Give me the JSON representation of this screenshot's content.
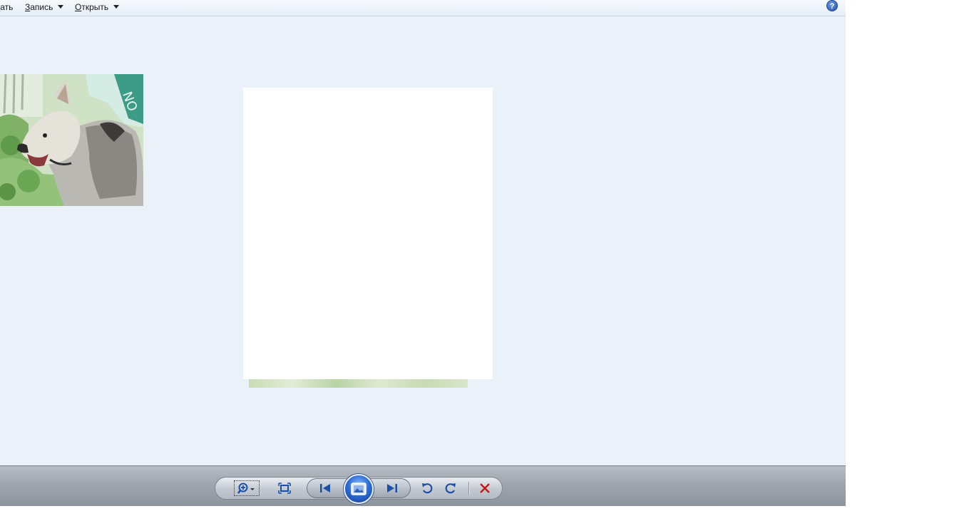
{
  "menubar": {
    "print_label": "чать",
    "burn_label": "Запись",
    "open_label": "Открыть",
    "help_glyph": "?"
  },
  "viewer": {
    "images": [
      "dog-photo",
      "blank-white-photo",
      "partial-grass-photo"
    ]
  },
  "controls": {
    "zoom": "magnifier-zoom-icon",
    "actual_size": "fit-to-window-icon",
    "previous": "previous-icon",
    "slideshow": "slideshow-icon",
    "next": "next-icon",
    "rotate_ccw": "rotate-counterclockwise-icon",
    "rotate_cw": "rotate-clockwise-icon",
    "delete": "delete-icon"
  },
  "colors": {
    "viewer_background": "#ebf1f8",
    "icon_blue": "#1c4fa8",
    "delete_red": "#c8161d"
  }
}
